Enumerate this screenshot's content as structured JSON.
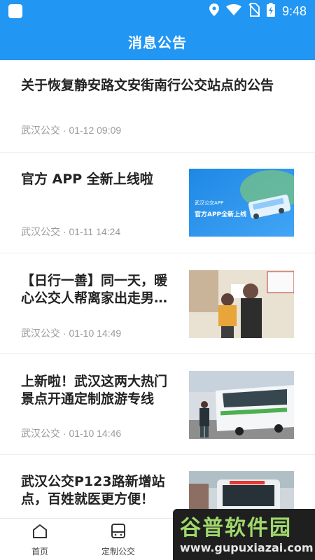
{
  "status_bar": {
    "time": "9:48",
    "icons": [
      "app-icon",
      "location-icon",
      "wifi-icon",
      "no-sim-icon",
      "battery-charging-icon"
    ]
  },
  "header": {
    "title": "消息公告"
  },
  "news": [
    {
      "title": "关于恢复静安路文安街南行公交站点的公告",
      "source": "武汉公交 · 01-12 09:09",
      "has_image": false
    },
    {
      "title": "官方 APP 全新上线啦",
      "source": "武汉公交 · 01-11 14:24",
      "has_image": true,
      "image_text": {
        "small": "武汉公交APP",
        "big": "官方APP全新上线"
      }
    },
    {
      "title": "【日行一善】同一天，暖心公交人帮离家出走男…",
      "source": "武汉公交 · 01-10 14:49",
      "has_image": true
    },
    {
      "title": "上新啦！武汉这两大热门景点开通定制旅游专线",
      "source": "武汉公交 · 01-10 14:46",
      "has_image": true
    },
    {
      "title": "武汉公交P123路新增站点，百姓就医更方便！",
      "source": "",
      "has_image": true
    }
  ],
  "bottom_nav": [
    {
      "label": "首页",
      "icon": "home-icon"
    },
    {
      "label": "定制公交",
      "icon": "bus-icon"
    }
  ],
  "watermark": {
    "brand": "谷普软件园",
    "url": "www.gupuxiazai.com"
  },
  "colors": {
    "primary": "#2196f3",
    "meta_text": "#9a9a9a",
    "title_text": "#222222"
  }
}
